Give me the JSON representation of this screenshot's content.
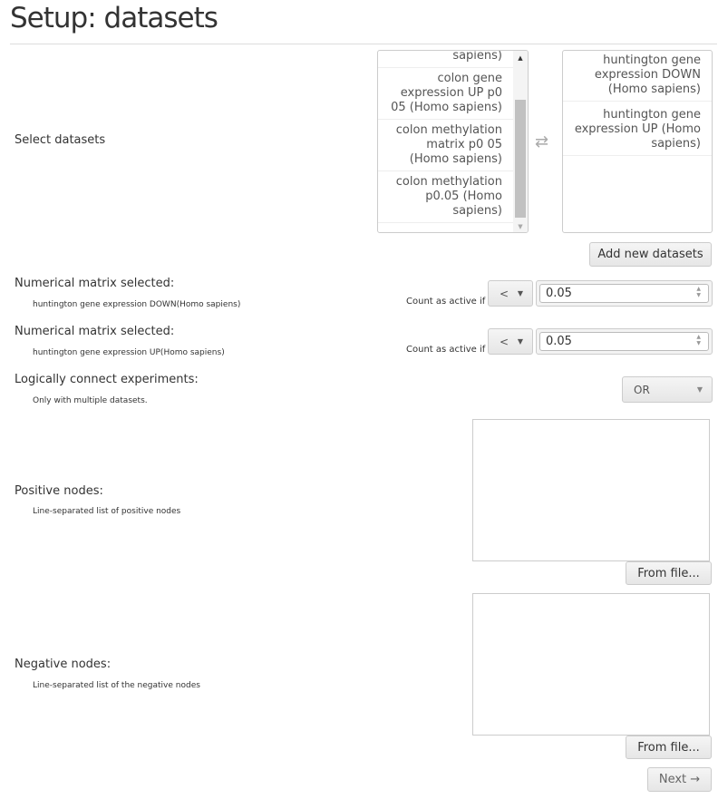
{
  "title": "Setup: datasets",
  "select_datasets_label": "Select datasets",
  "available": [
    "sapiens)",
    "colon gene expression UP p0 05 (Homo sapiens)",
    "colon methylation matrix p0 05 (Homo sapiens)",
    "colon methylation p0.05 (Homo sapiens)"
  ],
  "selected": [
    "huntington gene expression DOWN (Homo sapiens)",
    "huntington gene expression UP (Homo sapiens)"
  ],
  "add_new": "Add new datasets",
  "matrices": [
    {
      "label": "Numerical matrix selected:",
      "name": "huntington gene expression DOWN(Homo sapiens)",
      "count_label": "Count as active if",
      "operator": "<",
      "value": "0.05"
    },
    {
      "label": "Numerical matrix selected:",
      "name": "huntington gene expression UP(Homo sapiens)",
      "count_label": "Count as active if",
      "operator": "<",
      "value": "0.05"
    }
  ],
  "logic": {
    "label": "Logically connect experiments:",
    "hint": "Only with multiple datasets.",
    "value": "OR"
  },
  "positive": {
    "label": "Positive nodes:",
    "hint": "Line-separated list of positive nodes",
    "from_file": "From file..."
  },
  "negative": {
    "label": "Negative nodes:",
    "hint": "Line-separated list of the negative nodes",
    "from_file": "From file..."
  },
  "next": "Next →"
}
